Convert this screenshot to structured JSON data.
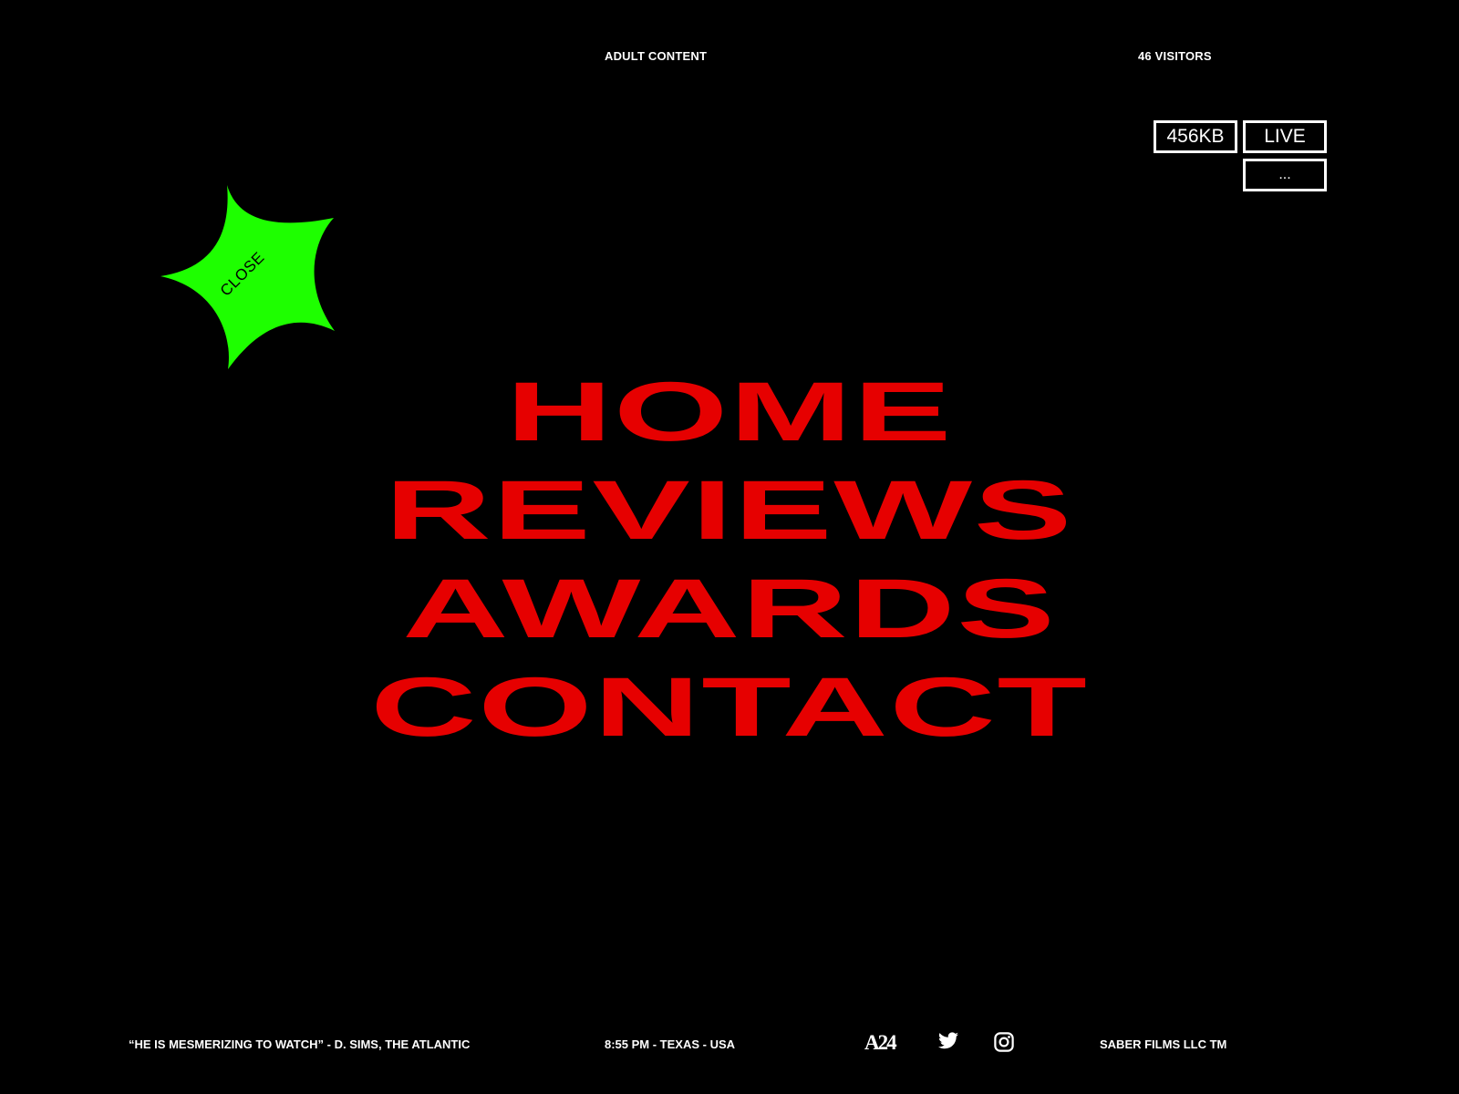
{
  "header": {
    "adult_content": "ADULT CONTENT",
    "visitors": "46 VISITORS"
  },
  "status": {
    "size": "456KB",
    "live": "LIVE",
    "more": "..."
  },
  "close_button": {
    "label": "CLOSE",
    "color": "#1eff00"
  },
  "nav": {
    "color": "#e60000",
    "items": [
      {
        "label": "HOME"
      },
      {
        "label": "REVIEWS"
      },
      {
        "label": "AWARDS"
      },
      {
        "label": "CONTACT"
      }
    ]
  },
  "footer": {
    "quote": "“HE IS MESMERIZING TO WATCH” - D. SIMS, THE ATLANTIC",
    "time": "8:55 PM - TEXAS - USA",
    "logo": "A24",
    "company": "SABER FILMS LLC TM",
    "icons": [
      "a24-logo",
      "twitter-icon",
      "instagram-icon"
    ]
  },
  "colors": {
    "background": "#000000",
    "text": "#ffffff"
  }
}
